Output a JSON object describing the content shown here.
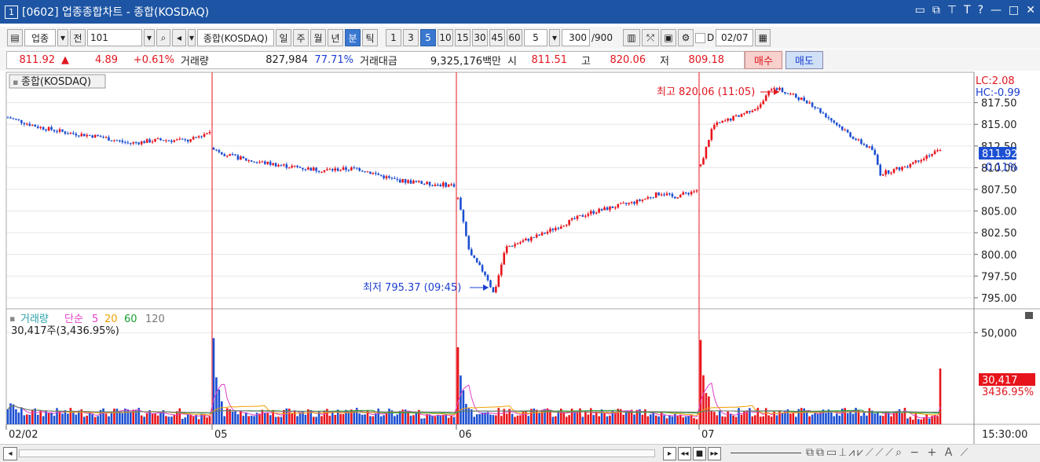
{
  "titlebar": {
    "window_num": "1",
    "title": "[0602] 업종종합차트 - 종합(KOSDAQ)"
  },
  "toolbar": {
    "category": "업종",
    "jeon": "전",
    "code": "101",
    "index_name": "종합(KOSDAQ)",
    "periods": [
      "일",
      "주",
      "월",
      "년",
      "분",
      "틱"
    ],
    "active_period": "분",
    "intervals": [
      "1",
      "3",
      "5",
      "10",
      "15",
      "30",
      "45",
      "60"
    ],
    "active_interval": "5",
    "interval_select": "5",
    "count": "300",
    "count_max": "/900",
    "date_label": "D",
    "date": "02/07"
  },
  "quote": {
    "price": "811.92",
    "arrow": "▲",
    "change": "4.89",
    "change_pct": "+0.61%",
    "vol_label": "거래량",
    "volume": "827,984",
    "vol_pct": "77.71%",
    "amt_label": "거래대금",
    "amount": "9,325,176백만",
    "open_label": "시",
    "open": "811.51",
    "high_label": "고",
    "high": "820.06",
    "low_label": "저",
    "low": "809.18",
    "buy": "매수",
    "sell": "매도"
  },
  "chart": {
    "legend": "종합(KOSDAQ)",
    "lc": "LC:2.08",
    "hc": "HC:-0.99",
    "price_badge": "811.92",
    "pct_badge": "-0.11%",
    "max_label": "최고 820.06 (11:05)",
    "min_label": "최저 795.37 (09:45)",
    "vol_legend": {
      "name": "거래량",
      "ma_name": "단순",
      "mas": [
        "5",
        "20",
        "60",
        "120"
      ]
    },
    "vol_value": "30,417주(3,436.95%)",
    "vol_badge": "30,417",
    "vol_badge_pct": "3436.95%",
    "time_label": "15:30:00"
  },
  "chart_data": {
    "type": "candlestick",
    "y_ticks": [
      "817.50",
      "815.00",
      "812.50",
      "810.00",
      "807.50",
      "805.00",
      "802.50",
      "800.00",
      "797.50",
      "795.00"
    ],
    "y_range": [
      794,
      821
    ],
    "vol_ticks": [
      "50,000"
    ],
    "x_labels": [
      "02/02",
      "05",
      "06",
      "07"
    ],
    "days": [
      {
        "label": "02/02",
        "points": [
          [
            0,
            815.8
          ],
          [
            0.15,
            814.7
          ],
          [
            0.3,
            814.0
          ],
          [
            0.45,
            813.6
          ],
          [
            0.6,
            812.8
          ],
          [
            0.75,
            813.2
          ],
          [
            0.9,
            813.1
          ],
          [
            1,
            814.2
          ]
        ]
      },
      {
        "label": "05",
        "points": [
          [
            0,
            812.3
          ],
          [
            0.05,
            811.5
          ],
          [
            0.15,
            810.8
          ],
          [
            0.3,
            810.2
          ],
          [
            0.45,
            809.7
          ],
          [
            0.6,
            809.9
          ],
          [
            0.75,
            808.6
          ],
          [
            0.9,
            808.1
          ],
          [
            1,
            808.0
          ]
        ]
      },
      {
        "label": "06",
        "points": [
          [
            0,
            806.5
          ],
          [
            0.05,
            800.0
          ],
          [
            0.12,
            797.5
          ],
          [
            0.15,
            795.4
          ],
          [
            0.2,
            800.8
          ],
          [
            0.35,
            802.3
          ],
          [
            0.45,
            803.6
          ],
          [
            0.55,
            804.8
          ],
          [
            0.75,
            806.1
          ],
          [
            0.85,
            807.1
          ],
          [
            0.9,
            806.6
          ],
          [
            1,
            807.4
          ]
        ]
      },
      {
        "label": "07",
        "points": [
          [
            0,
            810.2
          ],
          [
            0.05,
            814.8
          ],
          [
            0.15,
            815.9
          ],
          [
            0.25,
            817.2
          ],
          [
            0.3,
            819.4
          ],
          [
            0.35,
            818.7
          ],
          [
            0.45,
            817.6
          ],
          [
            0.55,
            815.4
          ],
          [
            0.65,
            813.2
          ],
          [
            0.72,
            812.0
          ],
          [
            0.75,
            809.3
          ],
          [
            0.85,
            810.1
          ],
          [
            0.95,
            811.5
          ],
          [
            1,
            811.9
          ]
        ]
      }
    ],
    "volume_spikes": [
      {
        "day": "05",
        "value": 47000
      },
      {
        "day": "06",
        "value": 42000
      },
      {
        "day": "07",
        "value": 46000
      },
      {
        "day": "07-last",
        "value": 30417
      }
    ],
    "max": {
      "value": 820.06,
      "time": "11:05"
    },
    "min": {
      "value": 795.37,
      "time": "09:45"
    }
  },
  "colors": {
    "up": "#e8141c",
    "down": "#1c4fd2",
    "title": "#1d55a4",
    "ma5": "#e040c8",
    "ma20": "#f0a000",
    "ma60": "#1aa030",
    "ma120": "#777777"
  }
}
